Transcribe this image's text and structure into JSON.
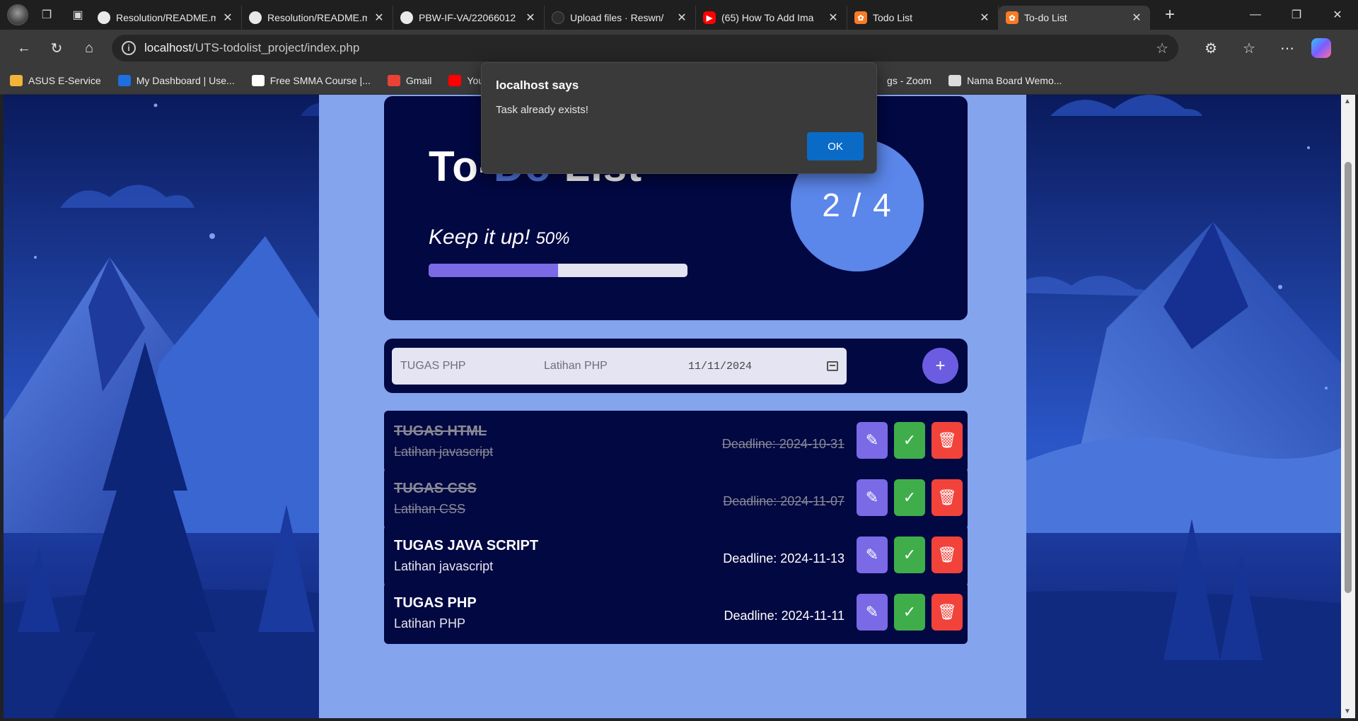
{
  "browser": {
    "tabs": [
      {
        "title": "Resolution/README.md",
        "icon": "github-icon",
        "favclass": "gh"
      },
      {
        "title": "Resolution/README.md",
        "icon": "github-icon",
        "favclass": "gh"
      },
      {
        "title": "PBW-IF-VA/22066012",
        "icon": "github-icon",
        "favclass": "gh"
      },
      {
        "title": "Upload files · Reswn/",
        "icon": "github-icon",
        "favclass": "gh2"
      },
      {
        "title": "(65) How To Add Ima",
        "icon": "youtube-icon",
        "favclass": "yt"
      },
      {
        "title": "Todo List",
        "icon": "xampp-icon",
        "favclass": "xampp"
      },
      {
        "title": "To-do List",
        "icon": "xampp-icon",
        "favclass": "xampp",
        "active": true
      }
    ],
    "url_host": "localhost",
    "url_path": "/UTS-todolist_project/index.php",
    "bookmarks": [
      {
        "label": "ASUS E-Service",
        "color": "#f2b43a"
      },
      {
        "label": "My Dashboard | Use...",
        "color": "#1e6fe0"
      },
      {
        "label": "Free SMMA Course |...",
        "color": "#ffffff"
      },
      {
        "label": "Gmail",
        "color": "#ea4335"
      },
      {
        "label": "You",
        "color": "#ff0000"
      },
      {
        "label": "gs - Zoom",
        "color": "#3a3a3a"
      },
      {
        "label": "Nama Board Wemo...",
        "color": "#dddddd"
      }
    ]
  },
  "hero": {
    "title_pre": "To-",
    "title_do": "Do",
    "title_post": " List",
    "message": "Keep it up!",
    "percent_text": "50%",
    "progress": 0.5,
    "counter": "2 / 4"
  },
  "form": {
    "task_value": "TUGAS PHP",
    "desc_value": "Latihan PHP",
    "date_value": "11/11/2024",
    "add_label": "+"
  },
  "tasks": [
    {
      "name": "TUGAS HTML",
      "desc": "Latihan javascript",
      "deadline": "Deadline: 2024-10-31",
      "done": true
    },
    {
      "name": "TUGAS CSS",
      "desc": "Latihan CSS",
      "deadline": "Deadline: 2024-11-07",
      "done": true
    },
    {
      "name": "TUGAS JAVA SCRIPT",
      "desc": "Latihan javascript",
      "deadline": "Deadline: 2024-11-13",
      "done": false
    },
    {
      "name": "TUGAS PHP",
      "desc": "Latihan PHP",
      "deadline": "Deadline: 2024-11-11",
      "done": false
    }
  ],
  "dialog": {
    "title": "localhost says",
    "message": "Task already exists!",
    "ok_label": "OK"
  },
  "colors": {
    "panel": "#85a4ee",
    "card": "#020842",
    "accent": "#5578e6",
    "edit": "#7a6ae6",
    "complete": "#3fae4a",
    "delete": "#f2433b"
  }
}
